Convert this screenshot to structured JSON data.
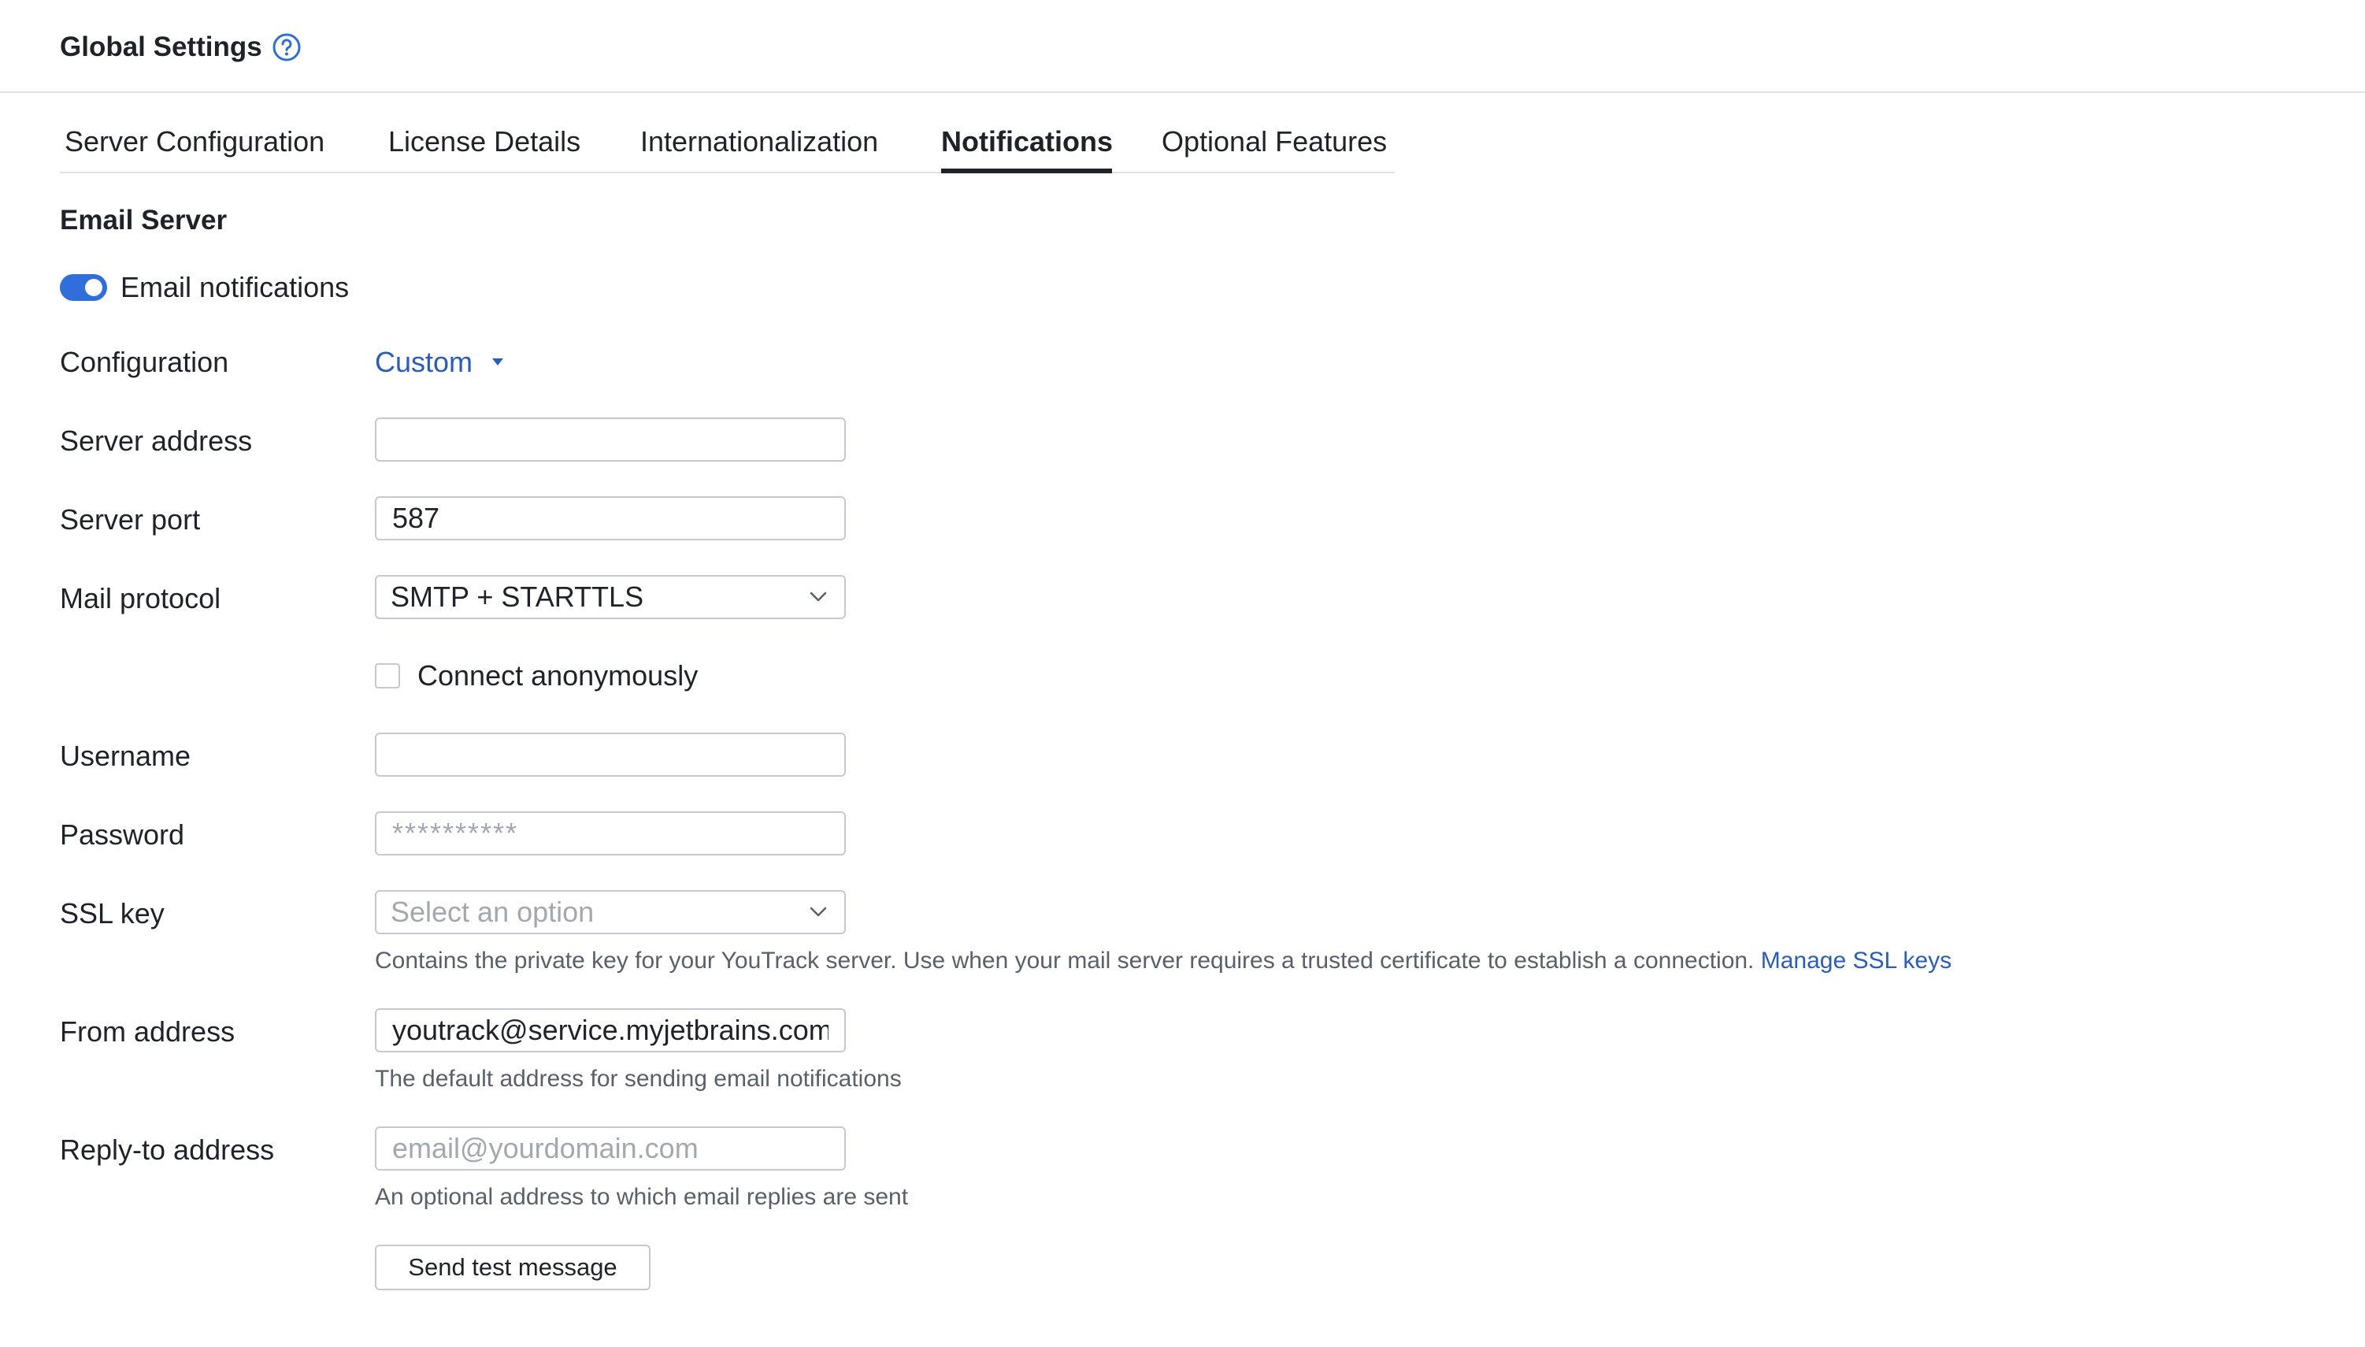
{
  "header": {
    "title": "Global Settings",
    "help_icon": "question-circle-icon"
  },
  "tabs": [
    {
      "label": "Server Configuration",
      "active": false
    },
    {
      "label": "License Details",
      "active": false
    },
    {
      "label": "Internationalization",
      "active": false
    },
    {
      "label": "Notifications",
      "active": true
    },
    {
      "label": "Optional Features",
      "active": false
    }
  ],
  "email_server": {
    "section_title": "Email Server",
    "toggle": {
      "label": "Email notifications",
      "on": true
    },
    "configuration": {
      "label": "Configuration",
      "value": "Custom"
    },
    "server_address": {
      "label": "Server address",
      "value": "",
      "placeholder": ""
    },
    "server_port": {
      "label": "Server port",
      "value": "587"
    },
    "mail_protocol": {
      "label": "Mail protocol",
      "value": "SMTP + STARTTLS"
    },
    "connect_anonymously": {
      "label": "Connect anonymously",
      "checked": false
    },
    "username": {
      "label": "Username",
      "value": ""
    },
    "password": {
      "label": "Password",
      "placeholder": "**********"
    },
    "ssl_key": {
      "label": "SSL key",
      "placeholder": "Select an option",
      "hint": "Contains the private key for your YouTrack server. Use when your mail server requires a trusted certificate to establish a connection.",
      "hint_link": "Manage SSL keys"
    },
    "from_address": {
      "label": "From address",
      "value": "youtrack@service.myjetbrains.com",
      "hint": "The default address for sending email notifications"
    },
    "reply_to_address": {
      "label": "Reply-to address",
      "placeholder": "email@yourdomain.com",
      "hint": "An optional address to which email replies are sent"
    },
    "send_test_label": "Send test message"
  },
  "colors": {
    "accent": "#2f6edb",
    "link": "#2a5cb8",
    "text": "#1f2329",
    "muted": "#5a6069",
    "border": "#c5c9d0"
  }
}
